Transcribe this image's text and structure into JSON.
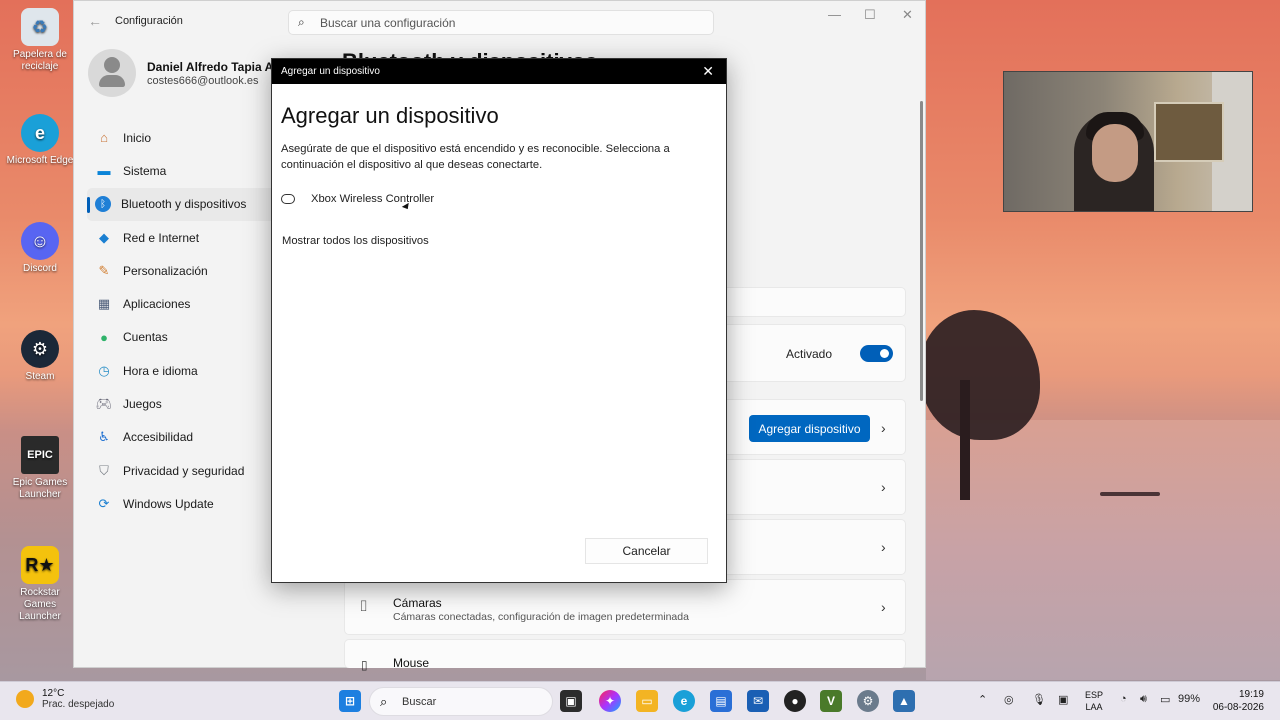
{
  "desktop": {
    "icons": [
      {
        "label": "Papelera de reciclaje",
        "icon": "recycle-bin-icon",
        "color": "#dfe6ec"
      },
      {
        "label": "Microsoft Edge",
        "icon": "edge-icon",
        "color": "#1aa0d8"
      },
      {
        "label": "Discord",
        "icon": "discord-icon",
        "color": "#5865f2"
      },
      {
        "label": "Steam",
        "icon": "steam-icon",
        "color": "#1b2838"
      },
      {
        "label": "Epic Games Launcher",
        "icon": "epic-games-icon",
        "color": "#2a2a2a"
      },
      {
        "label": "Rockstar Games Launcher",
        "icon": "rockstar-icon",
        "color": "#f4c20d"
      }
    ]
  },
  "settings": {
    "title": "Configuración",
    "search_placeholder": "Buscar una configuración",
    "user": {
      "name": "Daniel Alfredo Tapia Ara",
      "email": "costes666@outlook.es"
    },
    "nav": [
      {
        "label": "Inicio",
        "icon": "home-icon"
      },
      {
        "label": "Sistema",
        "icon": "system-icon"
      },
      {
        "label": "Bluetooth y dispositivos",
        "icon": "bluetooth-icon",
        "active": true
      },
      {
        "label": "Red e Internet",
        "icon": "wifi-icon"
      },
      {
        "label": "Personalización",
        "icon": "brush-icon"
      },
      {
        "label": "Aplicaciones",
        "icon": "apps-icon"
      },
      {
        "label": "Cuentas",
        "icon": "accounts-icon"
      },
      {
        "label": "Hora e idioma",
        "icon": "time-language-icon"
      },
      {
        "label": "Juegos",
        "icon": "gamepad-icon"
      },
      {
        "label": "Accesibilidad",
        "icon": "accessibility-icon"
      },
      {
        "label": "Privacidad y seguridad",
        "icon": "shield-icon"
      },
      {
        "label": "Windows Update",
        "icon": "update-icon"
      }
    ],
    "main": {
      "page_title": "Bluetooth y dispositivos",
      "bluetooth_state": "Activado",
      "add_device_button": "Agregar dispositivo",
      "cameras_title": "Cámaras",
      "cameras_subtitle": "Cámaras conectadas, configuración de imagen predeterminada",
      "mouse_title": "Mouse"
    }
  },
  "dialog": {
    "bar_title": "Agregar un dispositivo",
    "heading": "Agregar un dispositivo",
    "description": "Asegúrate de que el dispositivo está encendido y es reconocible. Selecciona a continuación el dispositivo al que deseas conectarte.",
    "device": "Xbox Wireless Controller",
    "show_all": "Mostrar todos los dispositivos",
    "cancel": "Cancelar"
  },
  "taskbar": {
    "temperature": "12°C",
    "weather": "Prac. despejado",
    "search_label": "Buscar",
    "language": "ESP",
    "layout": "LAA",
    "battery": "99%",
    "time": "19:19",
    "date": "06-08-2026"
  }
}
